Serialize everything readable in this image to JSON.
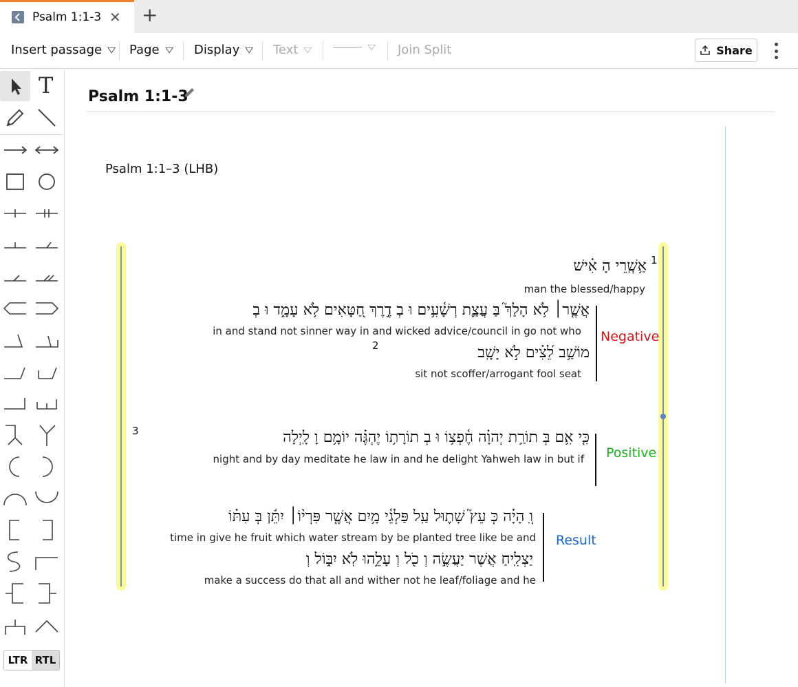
{
  "tab": {
    "title": "Psalm 1:1-3",
    "close": "✕",
    "add": "+"
  },
  "toolbar": {
    "insert_passage": "Insert passage",
    "page": "Page",
    "display": "Display",
    "text": "Text",
    "line": "——",
    "join_split": "Join Split",
    "share": "Share"
  },
  "palette": {
    "ltr": "LTR",
    "rtl": "RTL",
    "text_tool": "T"
  },
  "document": {
    "title": "Psalm 1:1-3",
    "passage_ref": "Psalm 1:1–3 (LHB)"
  },
  "verses": {
    "v1": "1",
    "v2": "2",
    "v3": "3"
  },
  "lines": {
    "l1": {
      "hebrew": "אַ֥שְֽׁרֵי הָ אִ֗ישׁ",
      "gloss": "man  the  blessed/happy"
    },
    "l2": {
      "hebrew": "אֲשֶׁ֤ר׀ לֹ֥א הָלַךְ֮ בַּ עֲצַ֪ת רְשָׁ֫עִ֥ים וּ בְ דֶ֣רֶךְ חַ֭טָּאִים לֹ֥א עָמָ֑ד וּ בְ",
      "gloss": "in and stand not sinner  way  in  and  wicked  advice/council  in  go  not  who"
    },
    "l3": {
      "hebrew": "מוֹשַׁ֥ב לֵ֝צִ֗ים לֹ֣א יָשָֽׁב",
      "gloss": "sit   not  scoffer/arrogant fool   seat"
    },
    "l4": {
      "hebrew": "כִּ֤י אִ֥ם בְּ תוֹרַ֥ת יְהוָ֗ה חֶ֫פְצ֥וֹ וּ בְ תוֹרָת֥וֹ יֶהְגֶּ֗ה יוֹמָ֥ם וָ לָֽיְלָה",
      "gloss": "night  and  by day  meditate  he   law   in  and  he  delight  Yahweh   law   in   but if"
    },
    "l5": {
      "hebrew": "וְֽ הָיָ֗ה כְּ עֵץ֮ שָׁת֪וּל עַֽל פַּלְגֵ֫י מָ֥יִם אֲשֶׁ֤ר פִּרְי֨וֹ׀ יִתֵּ֬ן בְּ עִתּ֗וֹ",
      "gloss": "time  in  give  he  fruit  which  water  stream  by  be planted  tree  like   be   and"
    },
    "l6": {
      "hebrew": "יַצְלִֽיחַ אֲשֶׁר יַעֲשֶׂ֣ה וְ כֹ֖ל וְ עָלֵ֥הוּ לֹֽא יִבּ֑וֹל וְ",
      "gloss": "make a success   do   that   all   and wither  not  he  leaf/foliage  and  he"
    }
  },
  "labels": {
    "negative": "Negative",
    "positive": "Positive",
    "result": "Result"
  },
  "colors": {
    "negative": "#d01818",
    "positive": "#1bb51b",
    "result": "#1a66c8",
    "highlight": "#fbfb9a",
    "tab_accent": "#f07d2a"
  }
}
